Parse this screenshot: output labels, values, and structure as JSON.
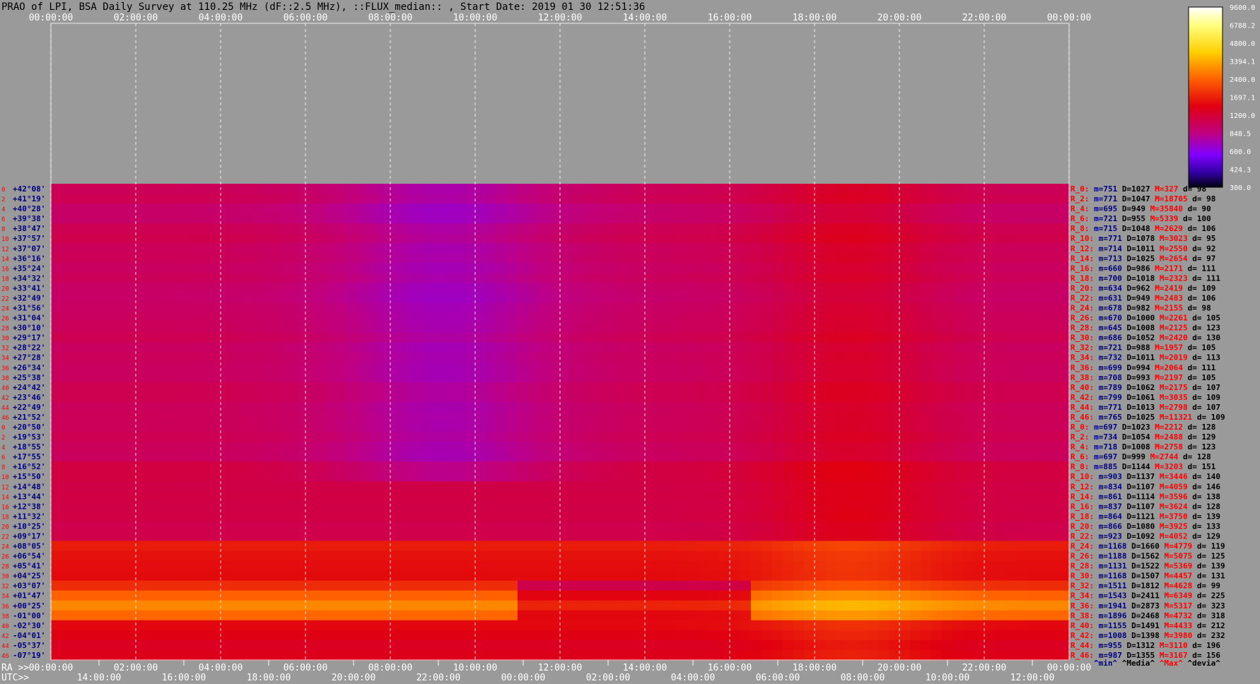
{
  "chart_data": {
    "type": "heatmap",
    "title": "PRAO of LPI, BSA Daily Survey at 110.25 MHz (dF::2.5 MHz), ::FLUX_median:: , Start Date: 2019 01 30 12:51:36",
    "top_axis_ticks": [
      "00:00:00",
      "02:00:00",
      "04:00:00",
      "06:00:00",
      "08:00:00",
      "10:00:00",
      "12:00:00",
      "14:00:00",
      "16:00:00",
      "18:00:00",
      "20:00:00",
      "22:00:00",
      "00:00:00"
    ],
    "bottom_ra_label": "RA >>",
    "bottom_ra_ticks": [
      "00:00:00",
      "02:00:00",
      "04:00:00",
      "06:00:00",
      "08:00:00",
      "10:00:00",
      "12:00:00",
      "14:00:00",
      "16:00:00",
      "18:00:00",
      "20:00:00",
      "22:00:00",
      "00:00:00"
    ],
    "bottom_utc_label": "UTC>>",
    "bottom_utc_ticks": [
      "14:00:00",
      "16:00:00",
      "18:00:00",
      "20:00:00",
      "22:00:00",
      "00:00:00",
      "02:00:00",
      "04:00:00",
      "06:00:00",
      "08:00:00",
      "10:00:00",
      "12:00:00"
    ],
    "colorbar_ticks": [
      "9600.0",
      "6788.2",
      "4800.0",
      "3394.1",
      "2400.0",
      "1697.1",
      "1200.0",
      "848.5",
      "600.0",
      "424.3",
      "300.0"
    ],
    "colorbar_range": [
      300,
      9600
    ],
    "row_numbers": [
      "0",
      "2",
      "4",
      "6",
      "8",
      "10",
      "12",
      "14",
      "16",
      "18",
      "20",
      "22",
      "24",
      "26",
      "28",
      "30",
      "32",
      "34",
      "36",
      "38",
      "40",
      "42",
      "44",
      "46",
      "0",
      "2",
      "4",
      "6",
      "8",
      "10",
      "12",
      "14",
      "16",
      "18",
      "20",
      "22",
      "24",
      "26",
      "28",
      "30",
      "32",
      "34",
      "36",
      "38",
      "40",
      "42",
      "44",
      "46"
    ],
    "declinations": [
      "+42°08'",
      "+41°19'",
      "+40°28'",
      "+39°38'",
      "+38°47'",
      "+37°57'",
      "+37°07'",
      "+36°16'",
      "+35°24'",
      "+34°32'",
      "+33°41'",
      "+32°49'",
      "+31°56'",
      "+31°04'",
      "+30°10'",
      "+29°17'",
      "+28°22'",
      "+27°28'",
      "+26°34'",
      "+25°38'",
      "+24°42'",
      "+23°46'",
      "+22°49'",
      "+21°52'",
      "+20°50'",
      "+19°53'",
      "+18°55'",
      "+17°55'",
      "+16°52'",
      "+15°50'",
      "+14°48'",
      "+13°44'",
      "+12°38'",
      "+11°32'",
      "+10°25'",
      "+09°17'",
      "+08°05'",
      "+06°54'",
      "+05°41'",
      "+04°25'",
      "+03°07'",
      "+01°47'",
      "+00°25'",
      "-01°00'",
      "-02°30'",
      "-04°01'",
      "-05°37'",
      "-07°19'"
    ],
    "stats_header": [
      "^min^",
      "^Media^",
      "^Max^",
      "^devia^"
    ],
    "stats": [
      [
        "R_0:",
        "m=751",
        "D=1027",
        "M=327",
        "d= 98"
      ],
      [
        "R_2:",
        "m=771",
        "D=1047",
        "M=18705",
        "d= 98"
      ],
      [
        "R_4:",
        "m=695",
        "D=949",
        "M=35840",
        "d= 90"
      ],
      [
        "R_6:",
        "m=721",
        "D=955",
        "M=5339",
        "d= 100"
      ],
      [
        "R_8:",
        "m=715",
        "D=1048",
        "M=2629",
        "d= 106"
      ],
      [
        "R_10:",
        "m=771",
        "D=1078",
        "M=3023",
        "d= 95"
      ],
      [
        "R_12:",
        "m=714",
        "D=1011",
        "M=2550",
        "d= 92"
      ],
      [
        "R_14:",
        "m=713",
        "D=1025",
        "M=2654",
        "d= 97"
      ],
      [
        "R_16:",
        "m=660",
        "D=986",
        "M=2171",
        "d= 111"
      ],
      [
        "R_18:",
        "m=700",
        "D=1018",
        "M=2323",
        "d= 111"
      ],
      [
        "R_20:",
        "m=634",
        "D=962",
        "M=2419",
        "d= 109"
      ],
      [
        "R_22:",
        "m=631",
        "D=949",
        "M=2483",
        "d= 106"
      ],
      [
        "R_24:",
        "m=678",
        "D=982",
        "M=2155",
        "d= 98"
      ],
      [
        "R_26:",
        "m=670",
        "D=1000",
        "M=2261",
        "d= 105"
      ],
      [
        "R_28:",
        "m=645",
        "D=1008",
        "M=2125",
        "d= 123"
      ],
      [
        "R_30:",
        "m=686",
        "D=1052",
        "M=2420",
        "d= 130"
      ],
      [
        "R_32:",
        "m=721",
        "D=988",
        "M=1957",
        "d= 105"
      ],
      [
        "R_34:",
        "m=732",
        "D=1011",
        "M=2019",
        "d= 113"
      ],
      [
        "R_36:",
        "m=699",
        "D=994",
        "M=2064",
        "d= 111"
      ],
      [
        "R_38:",
        "m=708",
        "D=993",
        "M=2197",
        "d= 105"
      ],
      [
        "R_40:",
        "m=789",
        "D=1062",
        "M=2175",
        "d= 107"
      ],
      [
        "R_42:",
        "m=799",
        "D=1061",
        "M=3035",
        "d= 109"
      ],
      [
        "R_44:",
        "m=771",
        "D=1013",
        "M=2798",
        "d= 107"
      ],
      [
        "R_46:",
        "m=765",
        "D=1025",
        "M=11321",
        "d= 109"
      ],
      [
        "R_0:",
        "m=697",
        "D=1023",
        "M=2212",
        "d= 128"
      ],
      [
        "R_2:",
        "m=734",
        "D=1054",
        "M=2488",
        "d= 129"
      ],
      [
        "R_4:",
        "m=718",
        "D=1008",
        "M=2758",
        "d= 123"
      ],
      [
        "R_6:",
        "m=697",
        "D=999",
        "M=2744",
        "d= 128"
      ],
      [
        "R_8:",
        "m=885",
        "D=1144",
        "M=3203",
        "d= 151"
      ],
      [
        "R_10:",
        "m=903",
        "D=1137",
        "M=3446",
        "d= 140"
      ],
      [
        "R_12:",
        "m=834",
        "D=1107",
        "M=4059",
        "d= 146"
      ],
      [
        "R_14:",
        "m=861",
        "D=1114",
        "M=3596",
        "d= 138"
      ],
      [
        "R_16:",
        "m=837",
        "D=1107",
        "M=3624",
        "d= 128"
      ],
      [
        "R_18:",
        "m=864",
        "D=1121",
        "M=3750",
        "d= 139"
      ],
      [
        "R_20:",
        "m=866",
        "D=1080",
        "M=3925",
        "d= 133"
      ],
      [
        "R_22:",
        "m=923",
        "D=1092",
        "M=4052",
        "d= 129"
      ],
      [
        "R_24:",
        "m=1168",
        "D=1660",
        "M=4779",
        "d= 119"
      ],
      [
        "R_26:",
        "m=1188",
        "D=1562",
        "M=5075",
        "d= 125"
      ],
      [
        "R_28:",
        "m=1131",
        "D=1522",
        "M=5369",
        "d= 139"
      ],
      [
        "R_30:",
        "m=1168",
        "D=1507",
        "M=4457",
        "d= 131"
      ],
      [
        "R_32:",
        "m=1511",
        "D=1812",
        "M=4628",
        "d= 99"
      ],
      [
        "R_34:",
        "m=1543",
        "D=2411",
        "M=6349",
        "d= 225"
      ],
      [
        "R_36:",
        "m=1941",
        "D=2873",
        "M=5317",
        "d= 323"
      ],
      [
        "R_38:",
        "m=1896",
        "D=2468",
        "M=4732",
        "d= 318"
      ],
      [
        "R_40:",
        "m=1155",
        "D=1491",
        "M=4433",
        "d= 212"
      ],
      [
        "R_42:",
        "m=1008",
        "D=1398",
        "M=3980",
        "d= 232"
      ],
      [
        "R_44:",
        "m=955",
        "D=1312",
        "M=3110",
        "d= 196"
      ],
      [
        "R_46:",
        "m=987",
        "D=1355",
        "M=3167",
        "d= 156"
      ]
    ],
    "grid": true,
    "colors": {
      "background": "#9a9a9a",
      "title_text": "#000000",
      "axis_text": "#ffffff",
      "dec_text": "#000080",
      "row_num_text": "#ff0000",
      "stat_label": "#ff0000",
      "stat_min": "#000080",
      "stat_median": "#000000",
      "stat_max": "#ff0000",
      "stat_dev": "#000000"
    }
  }
}
